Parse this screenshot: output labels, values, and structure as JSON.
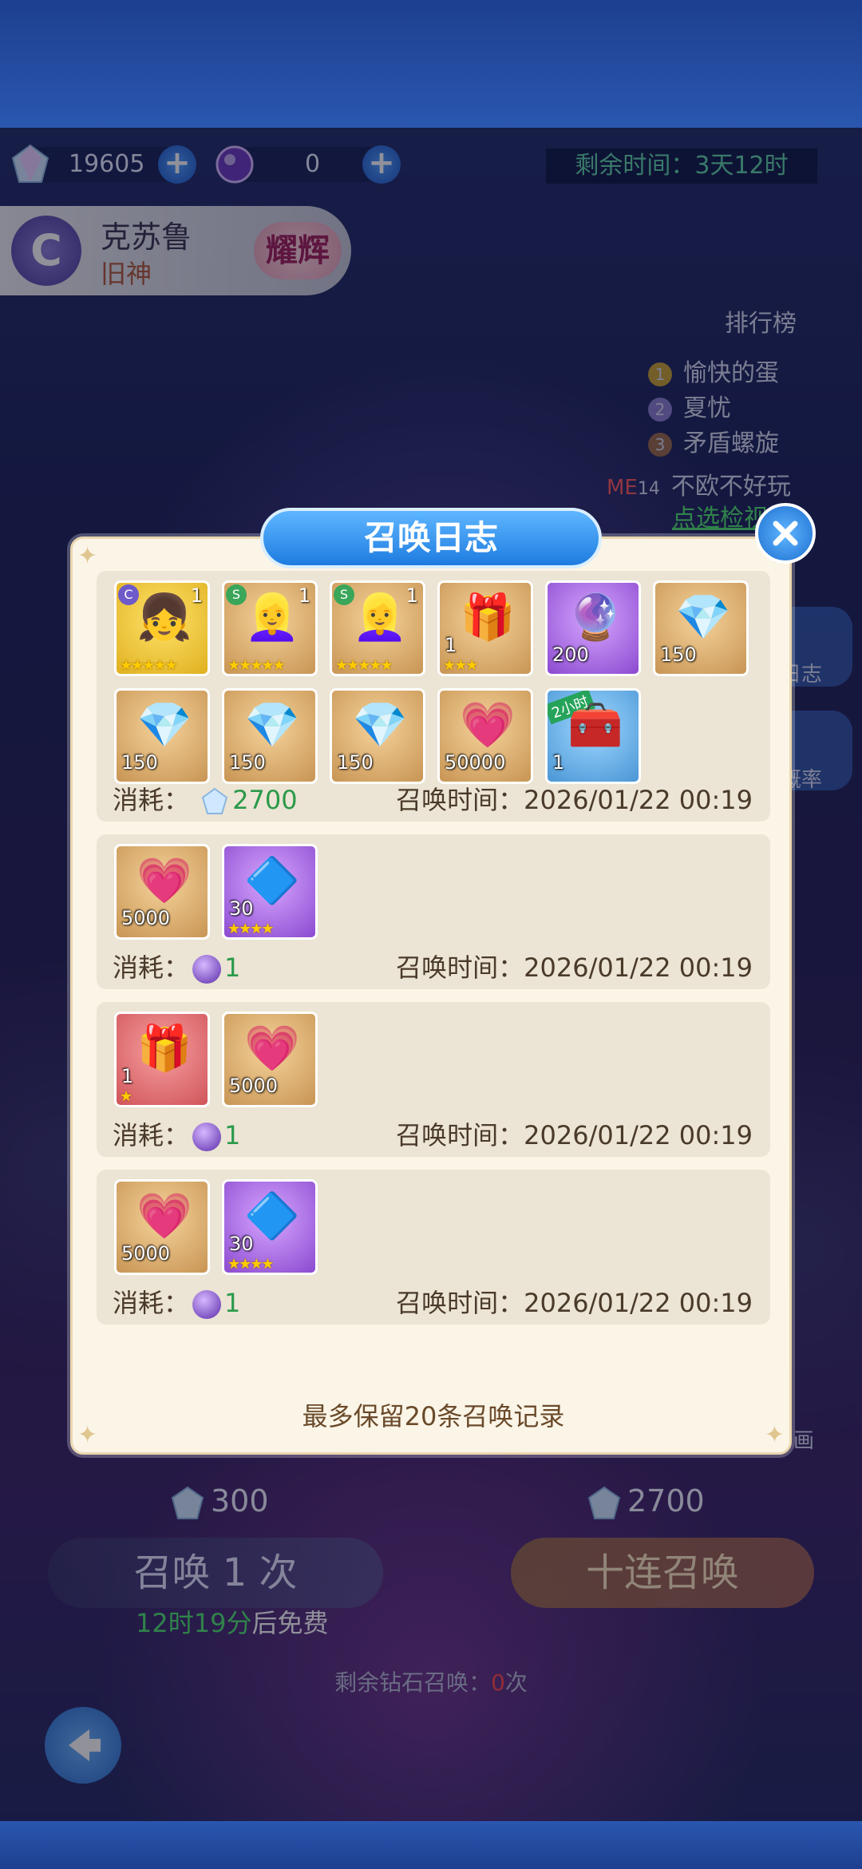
{
  "header": {
    "diamonds": "19605",
    "orbs": "0",
    "timer_label": "剩余时间：",
    "timer_value": "3天12时"
  },
  "pool": {
    "name": "克苏鲁",
    "subtitle": "旧神",
    "seal": "耀辉",
    "emblem": "C"
  },
  "ranking": {
    "title": "排行榜",
    "entries": [
      {
        "rank": "1",
        "name": "愉快的蛋"
      },
      {
        "rank": "2",
        "name": "夏忧"
      },
      {
        "rank": "3",
        "name": "矛盾螺旋"
      },
      {
        "rank": "14",
        "name": "不欧不好玩"
      }
    ],
    "me_label": "ME",
    "check_link": "点选检视"
  },
  "side": {
    "log_label": "日志",
    "prob_label": "概率",
    "anim_label": "画"
  },
  "modal": {
    "title": "召唤日志",
    "footer_note": "最多保留20条召唤记录",
    "cost_label": "消耗：",
    "time_label": "召唤时间：",
    "records": [
      {
        "cost": "2700",
        "cost_type": "diamond",
        "time": "2026/01/22 00:19",
        "items": [
          {
            "kind": "character",
            "lvl": "1",
            "stars": 5
          },
          {
            "kind": "character",
            "lvl": "1",
            "stars": 5
          },
          {
            "kind": "character",
            "lvl": "1",
            "stars": 5
          },
          {
            "kind": "chest",
            "qty": "1",
            "stars": 3
          },
          {
            "kind": "orb",
            "qty": "200"
          },
          {
            "kind": "diamond",
            "qty": "150"
          },
          {
            "kind": "diamond",
            "qty": "150"
          },
          {
            "kind": "diamond",
            "qty": "150"
          },
          {
            "kind": "diamond",
            "qty": "150"
          },
          {
            "kind": "exp",
            "qty": "50000"
          },
          {
            "kind": "treasure",
            "qty": "1",
            "tag": "2小时"
          }
        ]
      },
      {
        "cost": "1",
        "cost_type": "orb",
        "time": "2026/01/22 00:19",
        "items": [
          {
            "kind": "exp",
            "qty": "5000"
          },
          {
            "kind": "crystal",
            "qty": "30",
            "stars": 4
          }
        ]
      },
      {
        "cost": "1",
        "cost_type": "orb",
        "time": "2026/01/22 00:19",
        "items": [
          {
            "kind": "chest-red",
            "qty": "1",
            "stars": 1
          },
          {
            "kind": "exp",
            "qty": "5000"
          }
        ]
      },
      {
        "cost": "1",
        "cost_type": "orb",
        "time": "2026/01/22 00:19",
        "items": [
          {
            "kind": "exp",
            "qty": "5000"
          },
          {
            "kind": "crystal",
            "qty": "30",
            "stars": 4
          }
        ]
      }
    ]
  },
  "summon": {
    "single_cost": "300",
    "ten_cost": "2700",
    "single_label": "召唤 1 次",
    "ten_label": "十连召唤",
    "free_time": "12时19分",
    "free_suffix": "后免费",
    "remaining_prefix": "剩余钻石召唤：",
    "remaining_count": "0",
    "remaining_suffix": "次"
  },
  "colors": {
    "accent_blue": "#1e7ce0",
    "cost_green": "#2a9a4a",
    "timer_green": "#5fd3a7",
    "warning_red": "#ff4a4a"
  }
}
